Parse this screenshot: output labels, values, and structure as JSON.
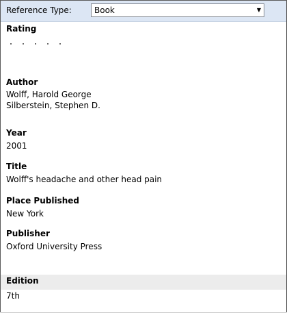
{
  "reference_type": {
    "label": "Reference Type:",
    "value": "Book"
  },
  "fields": {
    "rating": {
      "label": "Rating",
      "stars_filled": 0,
      "stars_total": 5
    },
    "author": {
      "label": "Author",
      "values": [
        "Wolff, Harold George",
        "Silberstein, Stephen D."
      ]
    },
    "year": {
      "label": "Year",
      "value": "2001"
    },
    "title": {
      "label": "Title",
      "value": "Wolff's headache and other head pain"
    },
    "place_published": {
      "label": "Place Published",
      "value": "New York"
    },
    "publisher": {
      "label": "Publisher",
      "value": "Oxford University Press"
    },
    "edition": {
      "label": "Edition",
      "value": "7th"
    }
  }
}
